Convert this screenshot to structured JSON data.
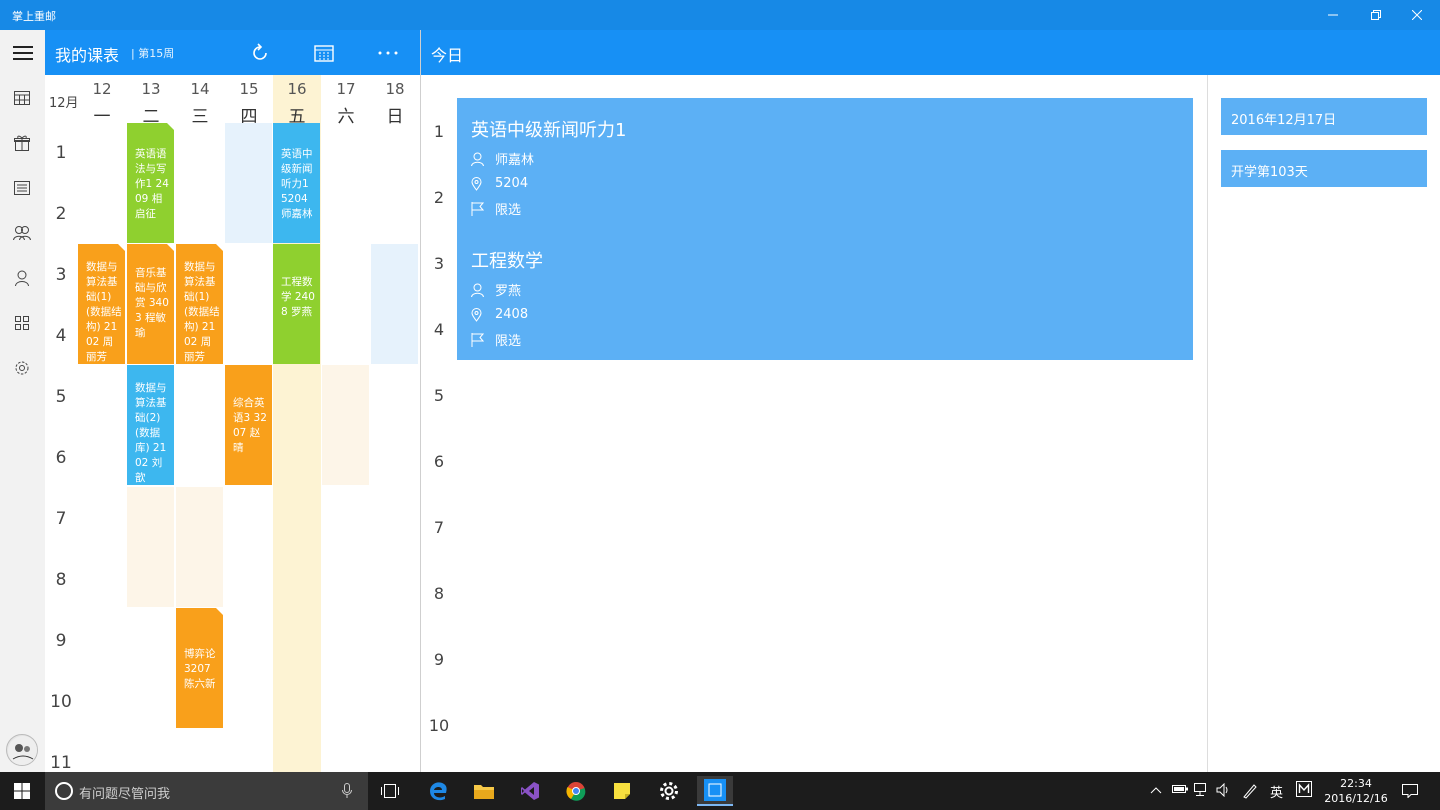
{
  "window": {
    "title": "掌上重邮"
  },
  "schedule": {
    "title": "我的课表",
    "week": "| 第15周",
    "month": "12月",
    "days": [
      {
        "num": "12",
        "name": "一"
      },
      {
        "num": "13",
        "name": "二"
      },
      {
        "num": "14",
        "name": "三"
      },
      {
        "num": "15",
        "name": "四"
      },
      {
        "num": "16",
        "name": "五"
      },
      {
        "num": "17",
        "name": "六"
      },
      {
        "num": "18",
        "name": "日"
      }
    ],
    "periods": [
      "1",
      "2",
      "3",
      "4",
      "5",
      "6",
      "7",
      "8",
      "9",
      "10",
      "11"
    ],
    "courses": [
      {
        "text": "英语语法与写作1 2409 相启征",
        "color": "#8fd02f"
      },
      {
        "text": "英语中级新闻听力1 5204 师嘉林",
        "color": "#3db7ef"
      },
      {
        "text": "数据与算法基础(1)(数据结构) 2102 周丽芳",
        "color": "#f9a01b"
      },
      {
        "text": "音乐基础与欣赏 3403 程敏瑜",
        "color": "#f9a01b"
      },
      {
        "text": "数据与算法基础(1)(数据结构) 2102 周丽芳",
        "color": "#f9a01b"
      },
      {
        "text": "工程数学 2408 罗燕",
        "color": "#8fd02f"
      },
      {
        "text": "数据与算法基础(2)(数据库) 2102 刘歆",
        "color": "#3db7ef"
      },
      {
        "text": "综合英语3 3207 赵晴",
        "color": "#f9a01b"
      },
      {
        "text": "博弈论 3207 陈六新",
        "color": "#f9a01b"
      }
    ]
  },
  "today": {
    "title": "今日",
    "periods": [
      "1",
      "2",
      "3",
      "4",
      "5",
      "6",
      "7",
      "8",
      "9",
      "10"
    ],
    "courses": [
      {
        "name": "英语中级新闻听力1",
        "teacher": "师嘉林",
        "room": "5204",
        "type": "限选"
      },
      {
        "name": "工程数学",
        "teacher": "罗燕",
        "room": "2408",
        "type": "限选"
      }
    ],
    "date": "2016年12月17日",
    "term_day": "开学第103天"
  },
  "taskbar": {
    "search_placeholder": "有问题尽管问我",
    "ime": "英",
    "time": "22:34",
    "date": "2016/12/16"
  }
}
